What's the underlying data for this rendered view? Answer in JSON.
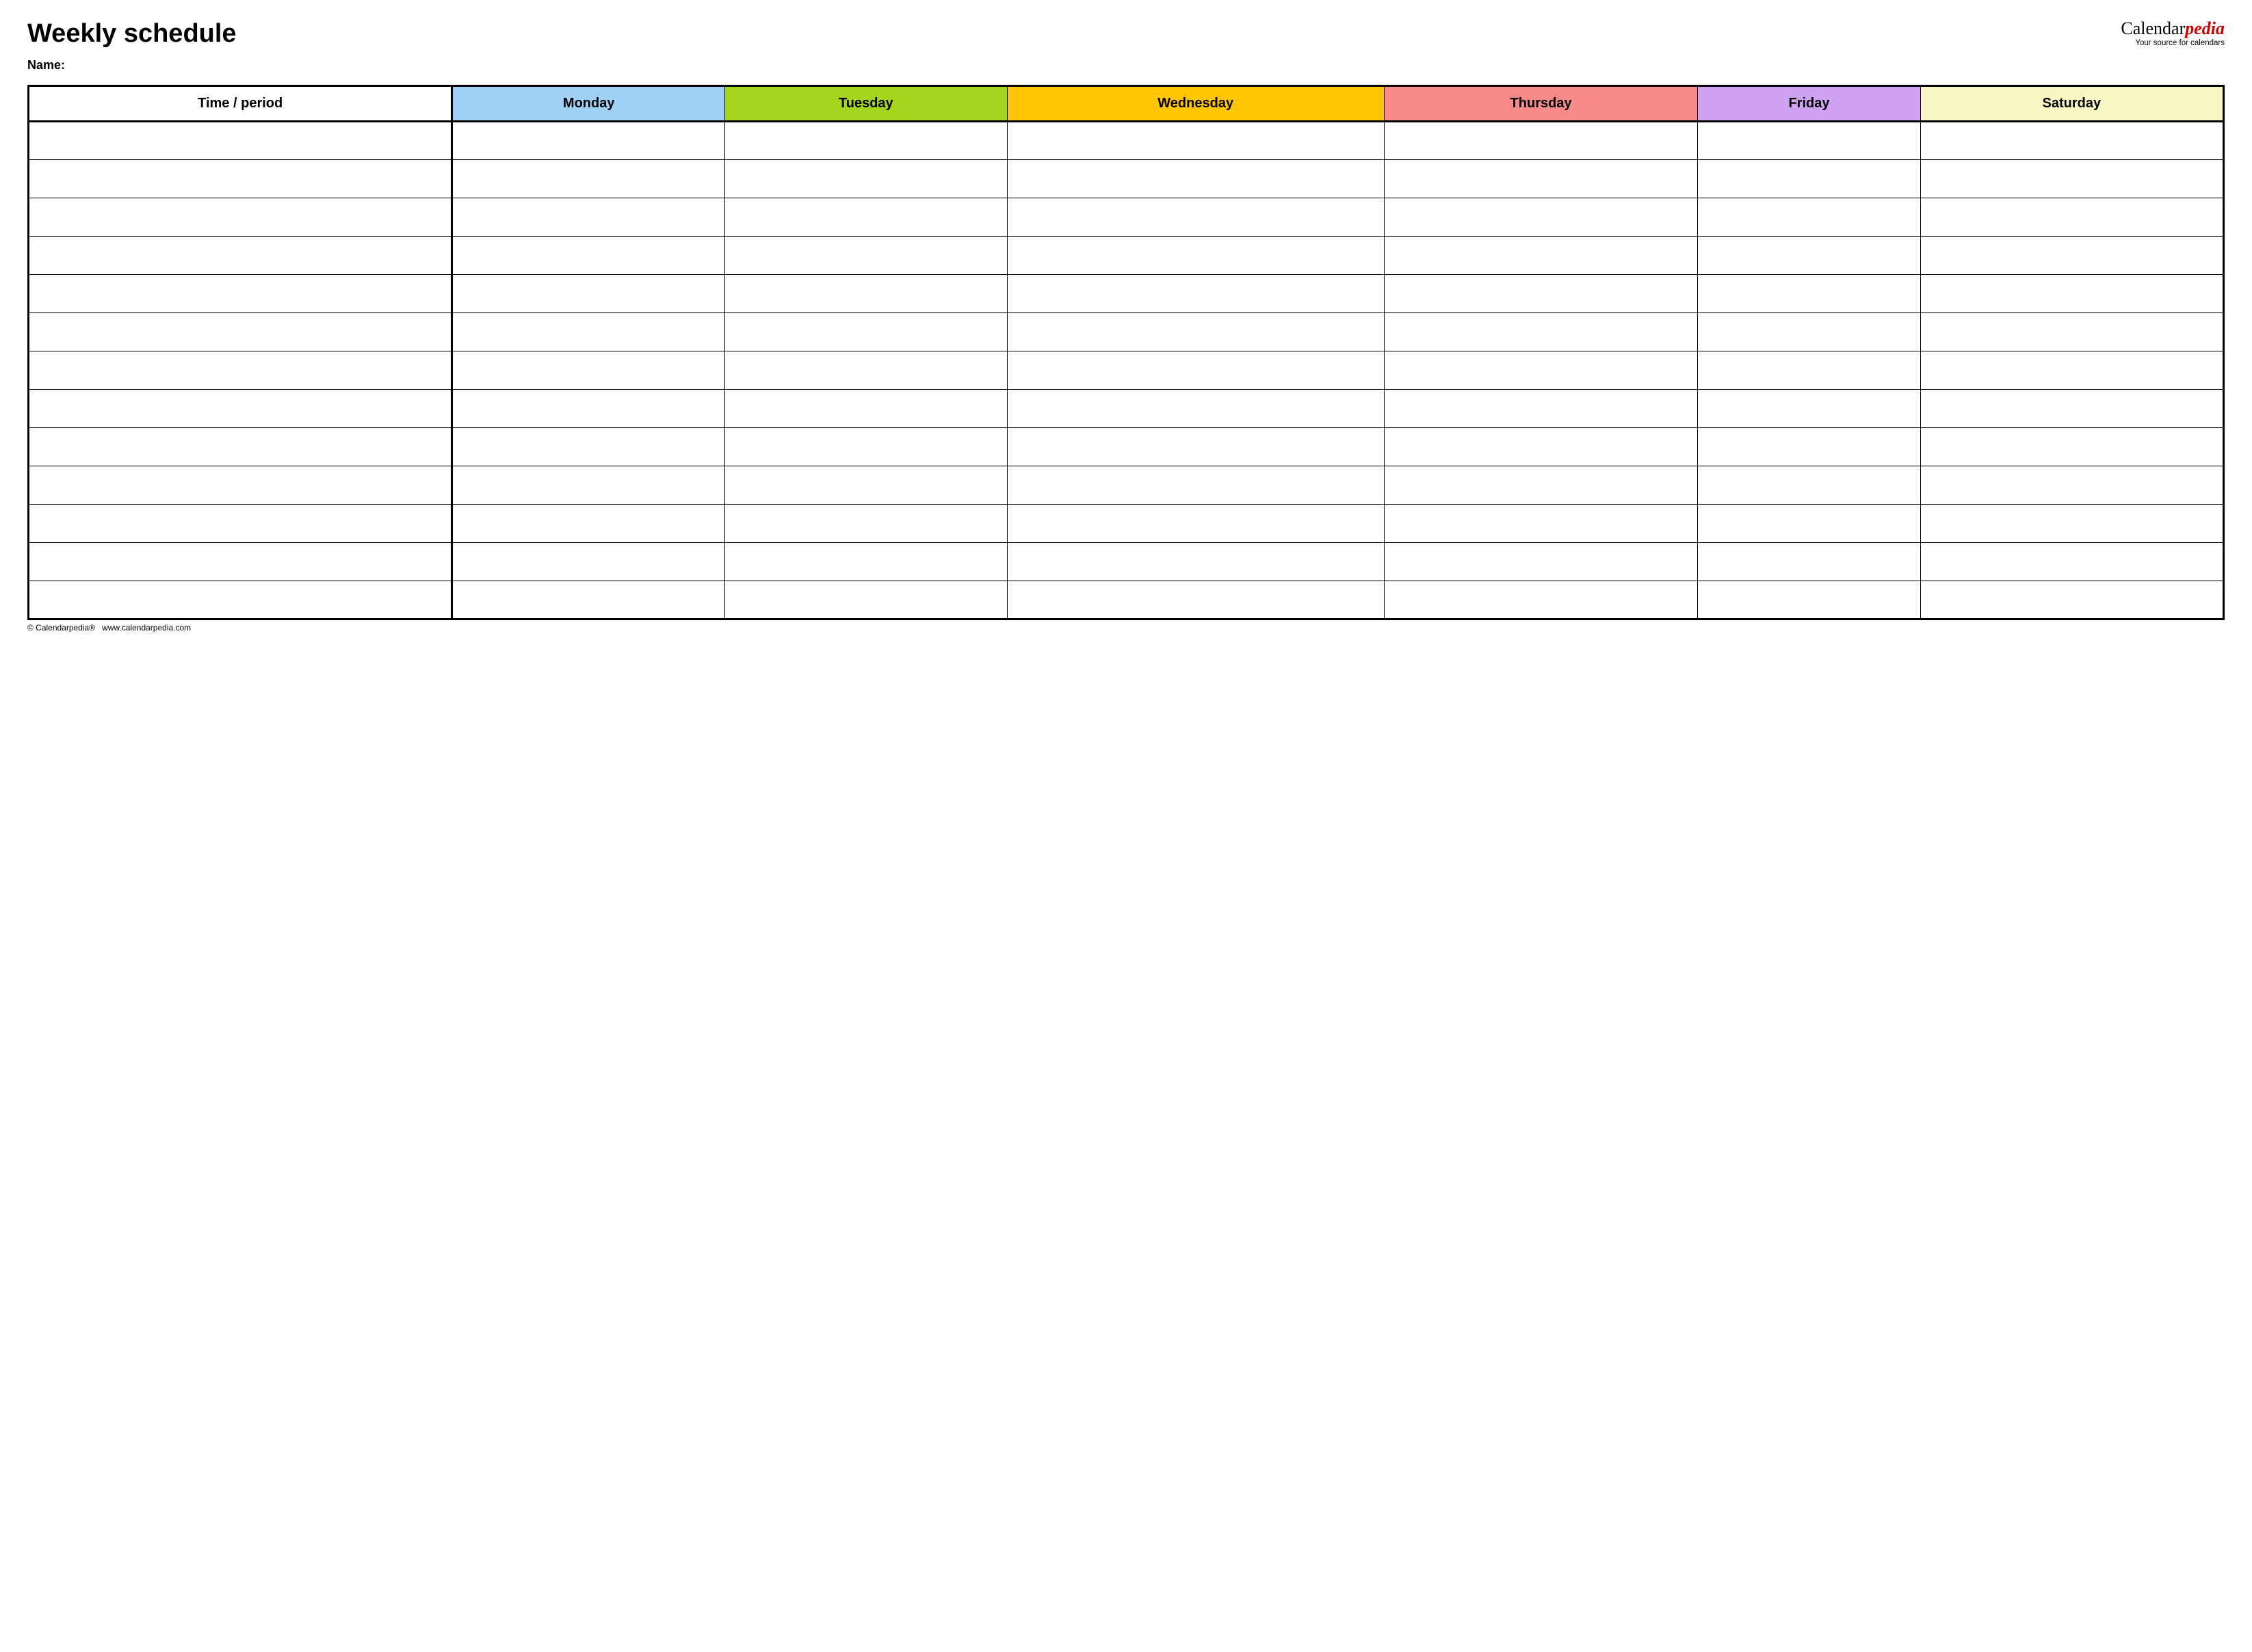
{
  "header": {
    "title": "Weekly schedule",
    "logo_prefix": "Calendar",
    "logo_accent": "pedia",
    "logo_tagline": "Your source for calendars"
  },
  "name_label": "Name:",
  "table": {
    "time_header": "Time / period",
    "days": [
      {
        "label": "Monday",
        "color": "#9fd0f6"
      },
      {
        "label": "Tuesday",
        "color": "#a4d41c"
      },
      {
        "label": "Wednesday",
        "color": "#ffc502"
      },
      {
        "label": "Thursday",
        "color": "#f68a8a"
      },
      {
        "label": "Friday",
        "color": "#cfa1f2"
      },
      {
        "label": "Saturday",
        "color": "#f8f7c3"
      }
    ],
    "row_count": 13
  },
  "footer": {
    "copyright": "© Calendarpedia®",
    "url": "www.calendarpedia.com"
  }
}
